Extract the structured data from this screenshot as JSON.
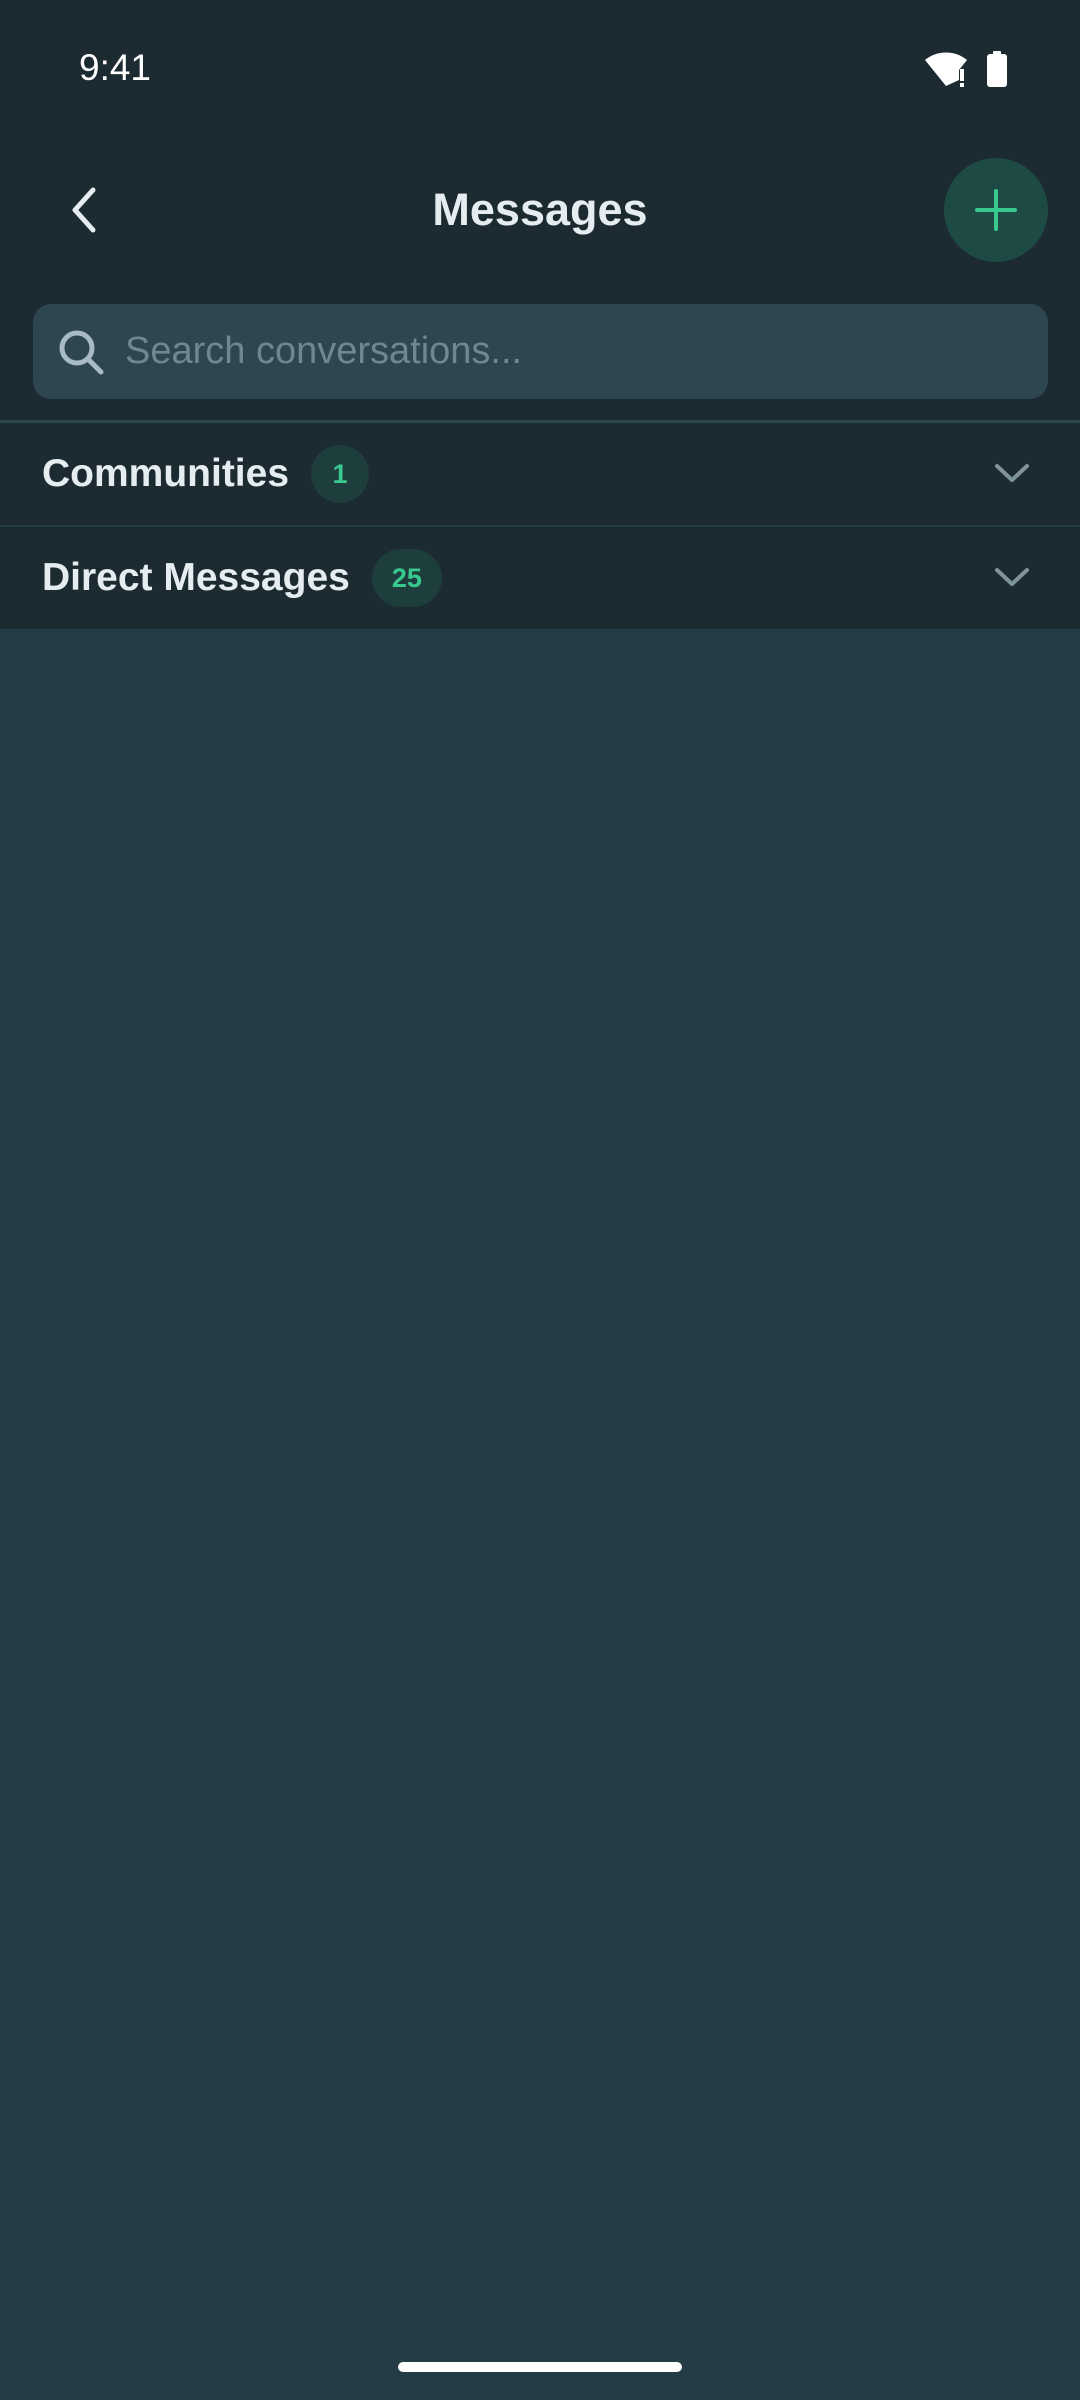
{
  "status_bar": {
    "time": "9:41",
    "icons": [
      "wifi-icon",
      "battery-icon"
    ]
  },
  "header": {
    "title": "Messages",
    "back_icon": "chevron-left-icon",
    "add_icon": "plus-icon"
  },
  "search": {
    "placeholder": "Search conversations...",
    "value": ""
  },
  "sections": [
    {
      "title": "Communities",
      "count": "1",
      "expanded": false
    },
    {
      "title": "Direct Messages",
      "count": "25",
      "expanded": false
    }
  ],
  "colors": {
    "background": "#243c45",
    "header_background": "#1c2a32",
    "accent": "#38c98e",
    "badge_background": "#1e3d3d",
    "search_background": "#2d4650"
  }
}
